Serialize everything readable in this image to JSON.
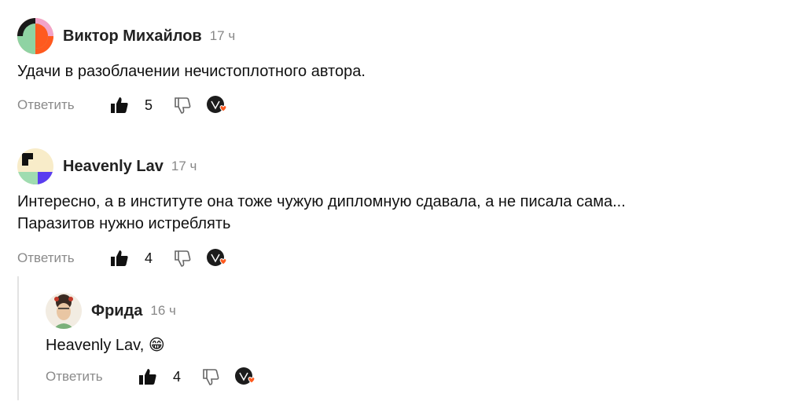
{
  "comments": [
    {
      "author": "Виктор Михайлов",
      "time": "17 ч",
      "text": "Удачи в разоблачении нечистоплотного автора.",
      "reply_label": "Ответить",
      "likes": "5"
    },
    {
      "author": "Heavenly Lav",
      "time": "17 ч",
      "text_line1": "Интересно, а в институте она тоже чужую дипломную сдавала, а не писала сама...",
      "text_line2": "Паразитов нужно истреблять",
      "reply_label": "Ответить",
      "likes": "4"
    },
    {
      "author": "Фрида",
      "time": "16 ч",
      "text": "Heavenly Lav,",
      "emoji": "😁",
      "reply_label": "Ответить",
      "likes": "4"
    }
  ],
  "icons": {
    "like": "thumbs-up-icon",
    "dislike": "thumbs-down-icon",
    "reactions": "reactions-icon"
  },
  "colors": {
    "reply_text": "#8a8a8a",
    "time_text": "#888888",
    "heart": "#ff5a1f"
  }
}
